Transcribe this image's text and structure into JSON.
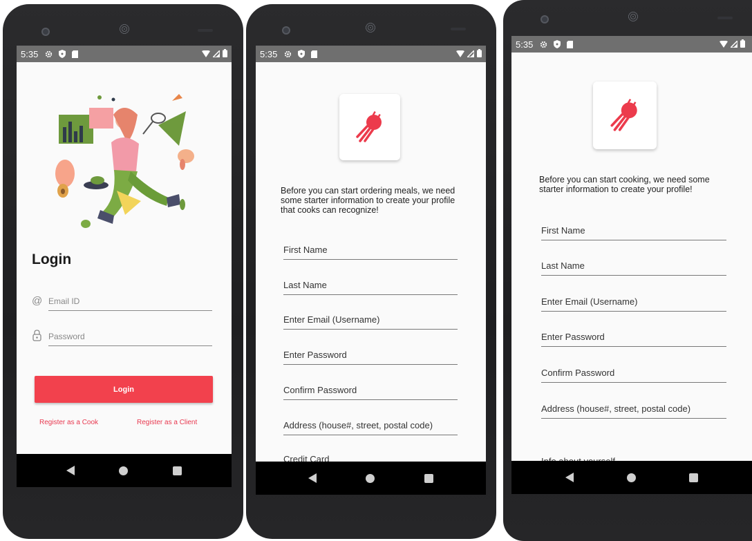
{
  "status_bar": {
    "time": "5:35"
  },
  "login_screen": {
    "title": "Login",
    "email_placeholder": "Email ID",
    "password_placeholder": "Password",
    "login_button": "Login",
    "register_cook_link": "Register as a Cook",
    "register_client_link": "Register as a Client"
  },
  "client_register": {
    "intro": "Before you can start ordering meals, we need some starter information to create your profile that cooks can recognize!",
    "fields": [
      "First Name",
      "Last Name",
      "Enter Email (Username)",
      "Enter Password",
      "Confirm Password",
      "Address (house#, street, postal code)",
      "Credit Card"
    ]
  },
  "cook_register": {
    "intro": "Before you can start cooking, we need some starter information to create your profile!",
    "fields": [
      "First Name",
      "Last Name",
      "Enter Email (Username)",
      "Enter Password",
      "Confirm Password",
      "Address (house#, street, postal code)",
      "Info about yourself"
    ]
  },
  "colors": {
    "accent": "#f2414d",
    "link": "#e8384f",
    "status_bar": "#6f6f6f"
  },
  "icons": [
    "settings-icon",
    "shield-icon",
    "sd-card-icon",
    "wifi-icon",
    "signal-icon",
    "battery-icon",
    "at-icon",
    "lock-icon",
    "app-logo-icon"
  ]
}
